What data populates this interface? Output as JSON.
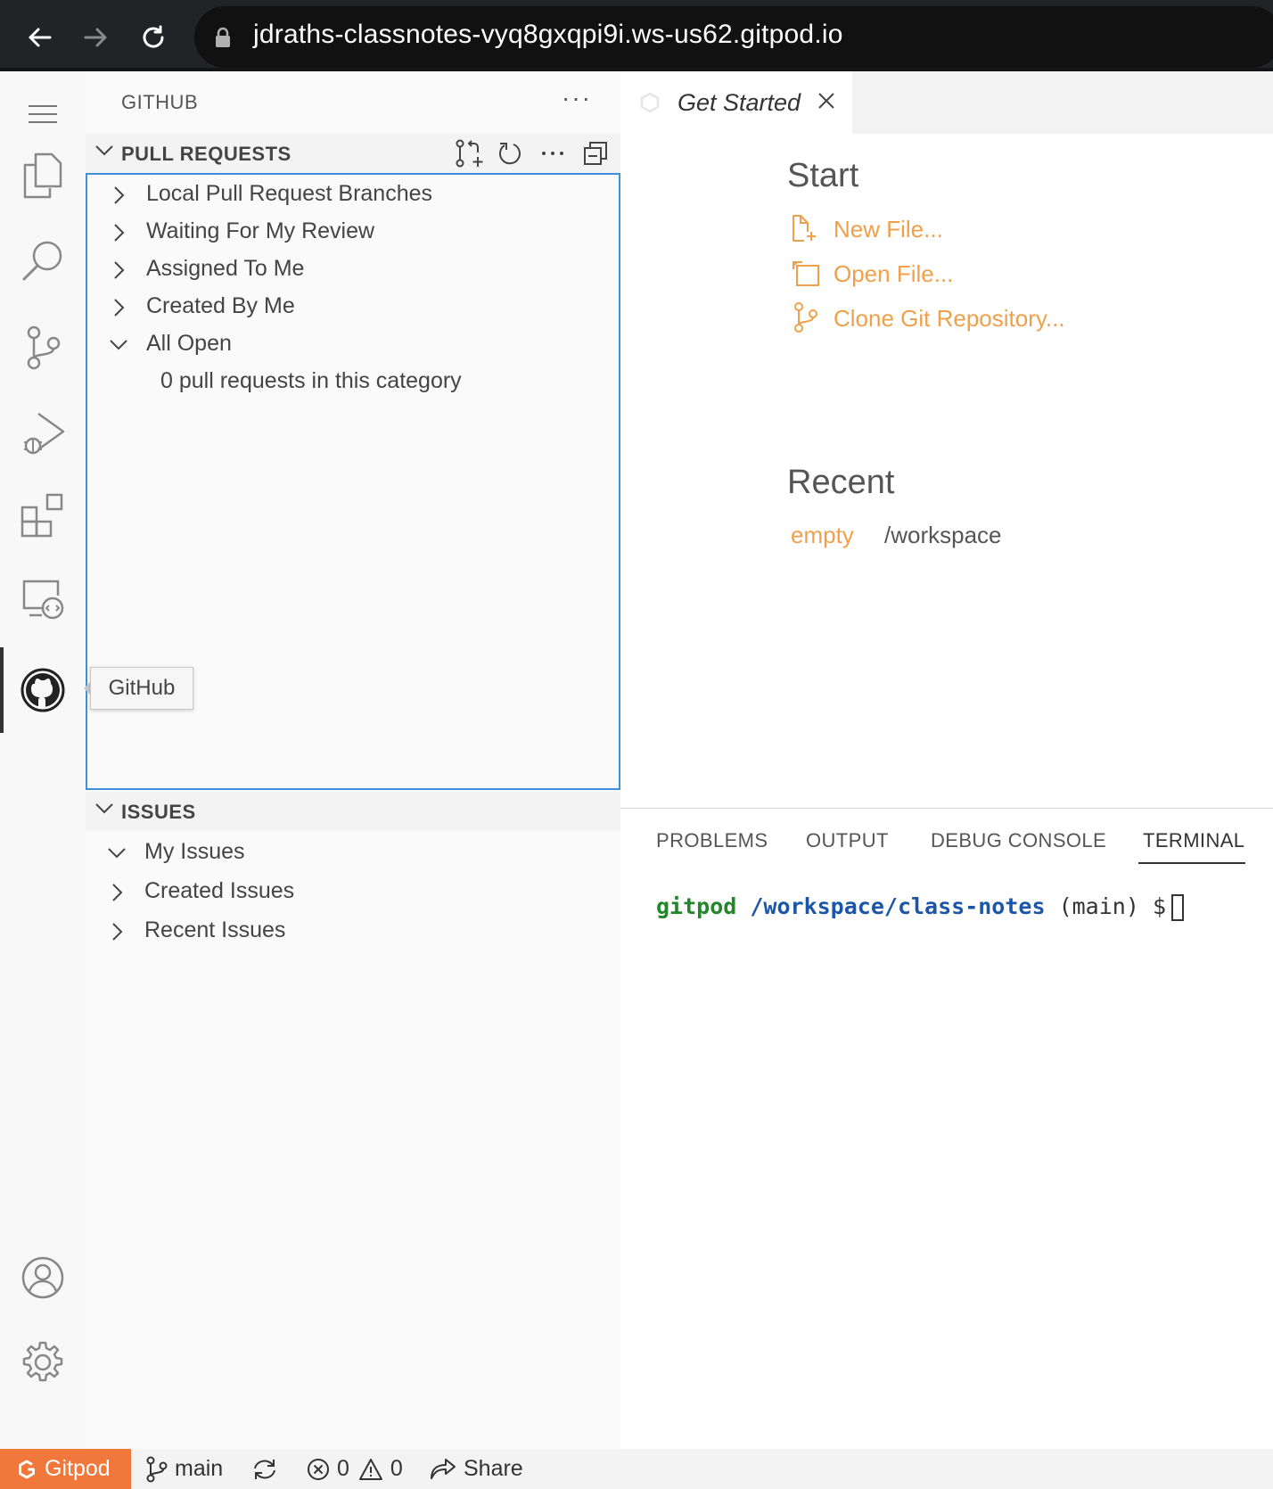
{
  "browser": {
    "url": "jdraths-classnotes-vyq8gxqpi9i.ws-us62.gitpod.io"
  },
  "sidebar": {
    "title": "GITHUB",
    "more": "···",
    "pull_requests": {
      "title": "PULL REQUESTS",
      "items": [
        {
          "label": "Local Pull Request Branches",
          "expanded": false
        },
        {
          "label": "Waiting For My Review",
          "expanded": false
        },
        {
          "label": "Assigned To Me",
          "expanded": false
        },
        {
          "label": "Created By Me",
          "expanded": false
        },
        {
          "label": "All Open",
          "expanded": true
        }
      ],
      "empty_message": "0 pull requests in this category"
    },
    "issues": {
      "title": "ISSUES",
      "items": [
        {
          "label": "My Issues",
          "expanded": true
        },
        {
          "label": "Created Issues",
          "expanded": false
        },
        {
          "label": "Recent Issues",
          "expanded": false
        }
      ]
    }
  },
  "tooltip": {
    "text": "GitHub"
  },
  "editor": {
    "tab_label": "Get Started",
    "start": {
      "heading": "Start",
      "links": [
        {
          "label": "New File...",
          "icon": "new-file-icon"
        },
        {
          "label": "Open File...",
          "icon": "open-file-icon"
        },
        {
          "label": "Clone Git Repository...",
          "icon": "git-clone-icon"
        }
      ]
    },
    "recent": {
      "heading": "Recent",
      "name": "empty",
      "path": "/workspace"
    }
  },
  "panel": {
    "tabs": [
      "PROBLEMS",
      "OUTPUT",
      "DEBUG CONSOLE",
      "TERMINAL"
    ],
    "active_tab": "TERMINAL",
    "terminal": {
      "user": "gitpod",
      "path": "/workspace/class-notes",
      "branch": "(main)",
      "prompt": "$"
    }
  },
  "status_bar": {
    "brand": "Gitpod",
    "branch": "main",
    "errors": "0",
    "warnings": "0",
    "share": "Share"
  },
  "colors": {
    "accent_link": "#f0a04b",
    "status_brand": "#f0783c",
    "focus_border": "#3c8fd9",
    "terminal_user": "#22862a",
    "terminal_path": "#1c56a8"
  }
}
